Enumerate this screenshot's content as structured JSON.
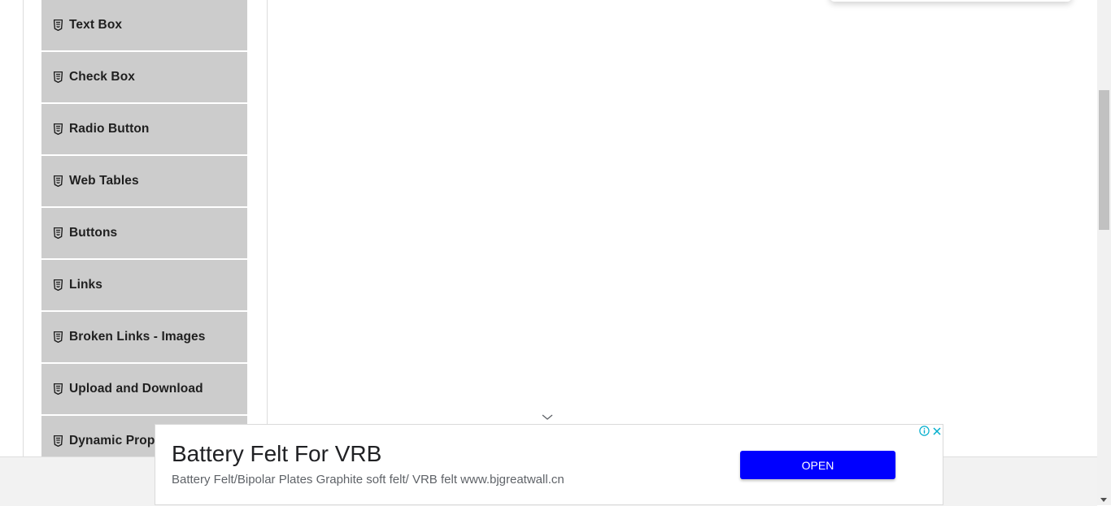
{
  "sidebar": {
    "items": [
      {
        "label": "Text Box",
        "icon": "html5-icon"
      },
      {
        "label": "Check Box",
        "icon": "html5-icon"
      },
      {
        "label": "Radio Button",
        "icon": "html5-icon"
      },
      {
        "label": "Web Tables",
        "icon": "html5-icon"
      },
      {
        "label": "Buttons",
        "icon": "html5-icon"
      },
      {
        "label": "Links",
        "icon": "html5-icon"
      },
      {
        "label": "Broken Links - Images",
        "icon": "html5-icon"
      },
      {
        "label": "Upload and Download",
        "icon": "html5-icon"
      },
      {
        "label": "Dynamic Prop",
        "icon": "html5-icon"
      }
    ]
  },
  "ad": {
    "title": "Battery Felt For VRB",
    "description": "Battery Felt/Bipolar Plates Graphite soft felt/ VRB felt www.bjgreatwall.cn",
    "button_label": "OPEN",
    "button_color": "#0000ff",
    "info_icon": "info-icon",
    "close_icon": "close-icon",
    "collapse_icon": "chevron-down-icon"
  },
  "colors": {
    "menu_item_bg": "#cccccc",
    "menu_text": "#1f1f1f"
  }
}
